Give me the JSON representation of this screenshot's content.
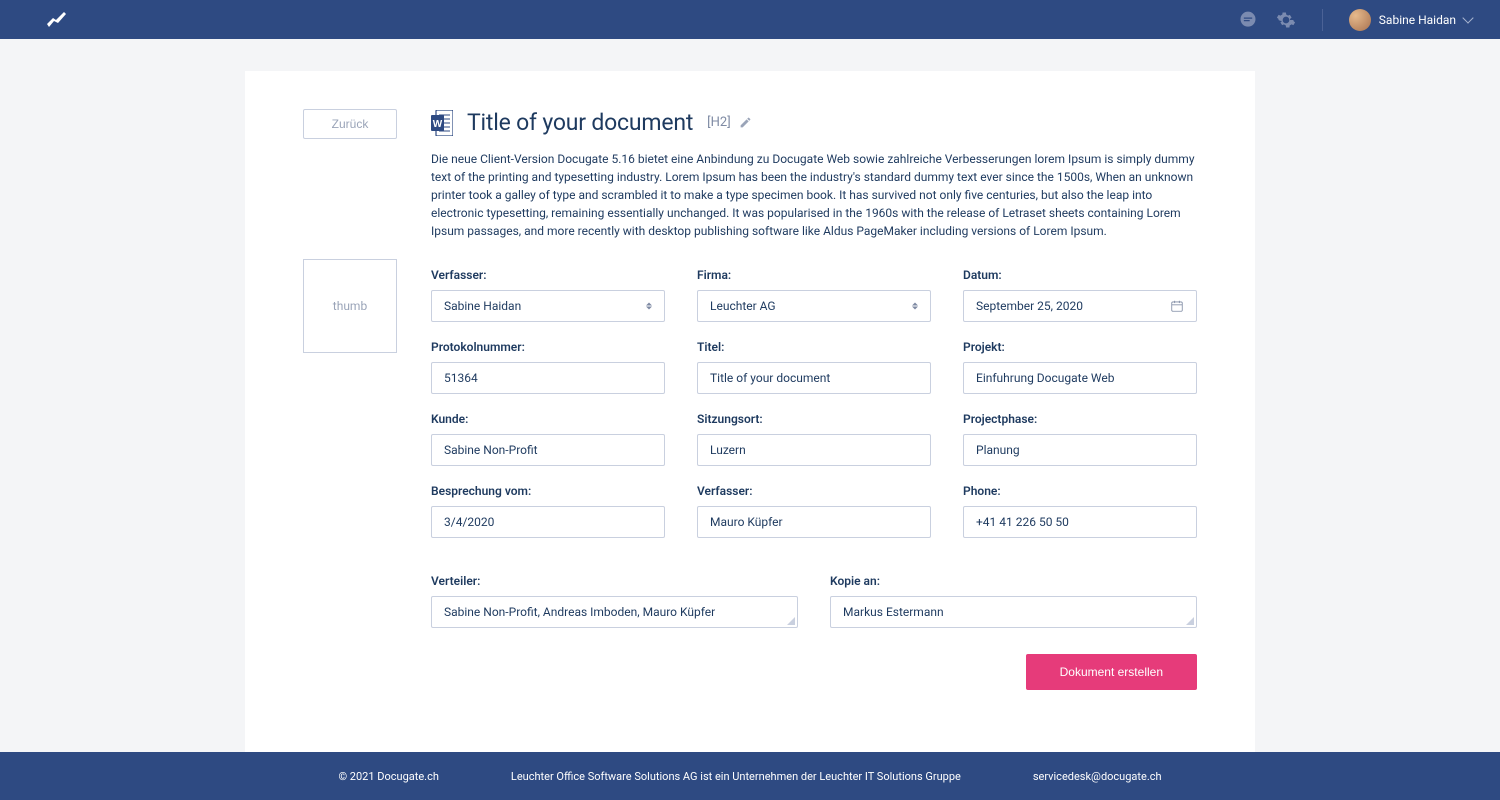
{
  "header": {
    "user_name": "Sabine Haidan"
  },
  "side": {
    "back_label": "Zurück",
    "thumb_label": "thumb"
  },
  "doc": {
    "title": "Title of your document",
    "h2_tag": "[H2]",
    "description": "Die neue Client-Version Docugate 5.16 bietet eine Anbindung zu Docugate Web sowie zahlreiche Verbesserungen lorem Ipsum is simply dummy text of the printing and typesetting industry. Lorem Ipsum has been the industry's standard dummy text ever since the 1500s, When an unknown printer took a galley of type and scrambled it to make a type specimen book. It has survived not only five centuries, but also the leap into electronic typesetting, remaining essentially unchanged. It was popularised in the 1960s with the release of Letraset sheets containing Lorem Ipsum passages, and more recently with desktop publishing software like Aldus PageMaker including versions of Lorem Ipsum."
  },
  "fields": {
    "verfasser": {
      "label": "Verfasser:",
      "value": "Sabine Haidan"
    },
    "firma": {
      "label": "Firma:",
      "value": "Leuchter AG"
    },
    "datum": {
      "label": "Datum:",
      "value": "September 25, 2020"
    },
    "protokolnummer": {
      "label": "Protokolnummer:",
      "value": "51364"
    },
    "titel": {
      "label": "Titel:",
      "value": "Title of your document"
    },
    "projekt": {
      "label": "Projekt:",
      "value": "Einfuhrung Docugate Web"
    },
    "kunde": {
      "label": "Kunde:",
      "value": "Sabine Non-Profit"
    },
    "sitzungsort": {
      "label": "Sitzungsort:",
      "value": "Luzern"
    },
    "projectphase": {
      "label": "Projectphase:",
      "value": "Planung"
    },
    "besprechung_vom": {
      "label": "Besprechung vom:",
      "value": "3/4/2020"
    },
    "verfasser2": {
      "label": "Verfasser:",
      "value": "Mauro Küpfer"
    },
    "phone": {
      "label": "Phone:",
      "value": "+41 41 226 50 50"
    },
    "verteiler": {
      "label": "Verteiler:",
      "value": "Sabine Non-Profit, Andreas Imboden, Mauro Küpfer"
    },
    "kopie_an": {
      "label": "Kopie an:",
      "value": "Markus Estermann"
    }
  },
  "actions": {
    "submit": "Dokument erstellen"
  },
  "footer": {
    "copyright": "© 2021 Docugate.ch",
    "company": "Leuchter Office Software Solutions AG ist ein Unternehmen der Leuchter IT Solutions Gruppe",
    "email": "servicedesk@docugate.ch"
  }
}
